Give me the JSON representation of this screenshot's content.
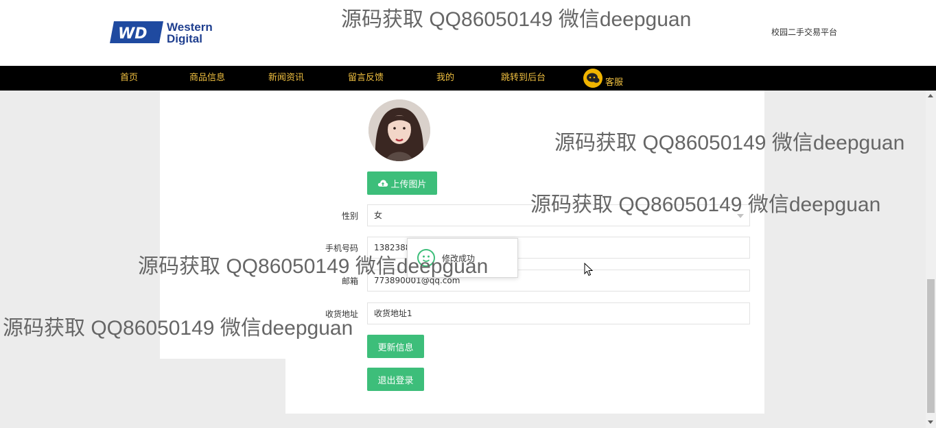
{
  "header": {
    "logo_line1": "Western",
    "logo_line2": "Digital",
    "logo_mark": "WD",
    "site_name": "校园二手交易平台"
  },
  "nav": {
    "items": [
      "首页",
      "商品信息",
      "新闻资讯",
      "留言反馈",
      "我的",
      "跳转到后台"
    ],
    "service_label": "客服"
  },
  "profile": {
    "upload_button": "上传图片",
    "fields": {
      "gender": {
        "label": "性别",
        "value": "女"
      },
      "phone": {
        "label": "手机号码",
        "value": "1382388"
      },
      "email": {
        "label": "邮箱",
        "value": "773890001@qq.com"
      },
      "address": {
        "label": "收货地址",
        "value": "收货地址1"
      }
    },
    "update_button": "更新信息",
    "logout_button": "退出登录"
  },
  "toast": {
    "message": "修改成功"
  },
  "watermark": "源码获取 QQ86050149 微信deepguan",
  "colors": {
    "nav_bg": "#000000",
    "nav_text": "#f0c040",
    "accent": "#3dbe7a",
    "page_bg": "#ececec"
  }
}
